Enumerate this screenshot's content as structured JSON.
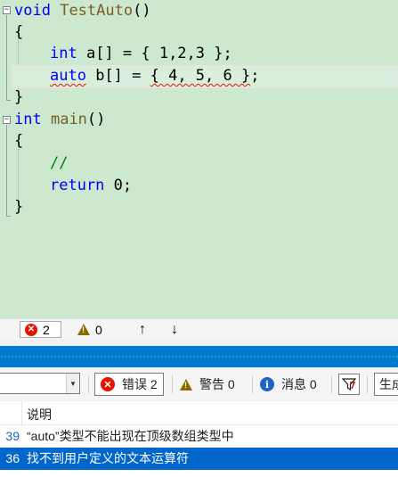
{
  "editor": {
    "lines": {
      "l1": {
        "kw": "void",
        "name": "TestAuto",
        "rest": "()"
      },
      "l2": "{",
      "l3": {
        "kw": "int",
        "rest": " a[] = { 1,2,3 };"
      },
      "l4": {
        "kw": "auto",
        "rest1": " b[] = ",
        "rest2": "{ 4, 5, 6 }",
        "rest3": ";"
      },
      "l5": "}",
      "l6": {
        "kw": "int",
        "name": "main",
        "rest": "()"
      },
      "l7": "{",
      "l8": "//",
      "l9": {
        "kw": "return",
        "rest": " 0;"
      },
      "l10": "}"
    },
    "fold_collapse_glyph": "−"
  },
  "status_strip": {
    "errors": "2",
    "warnings": "0",
    "up_arrow": "↑",
    "down_arrow": "↓"
  },
  "error_list": {
    "toolbar": {
      "scope_value": "",
      "errors_label": "错误 2",
      "warnings_label": "警告 0",
      "messages_label": "消息 0",
      "build_label": "生成"
    },
    "header": {
      "description": "说明"
    },
    "rows": [
      {
        "code": "39",
        "description": "“auto”类型不能出现在顶级数组类型中",
        "selected": false
      },
      {
        "code": "36",
        "description": "找不到用户定义的文本运算符",
        "selected": true
      }
    ]
  },
  "colors": {
    "editor_background": "#cce8cf",
    "keyword": "#0000ff",
    "error": "#e51400",
    "panel_accent": "#007acc",
    "selection": "#0066cc"
  }
}
